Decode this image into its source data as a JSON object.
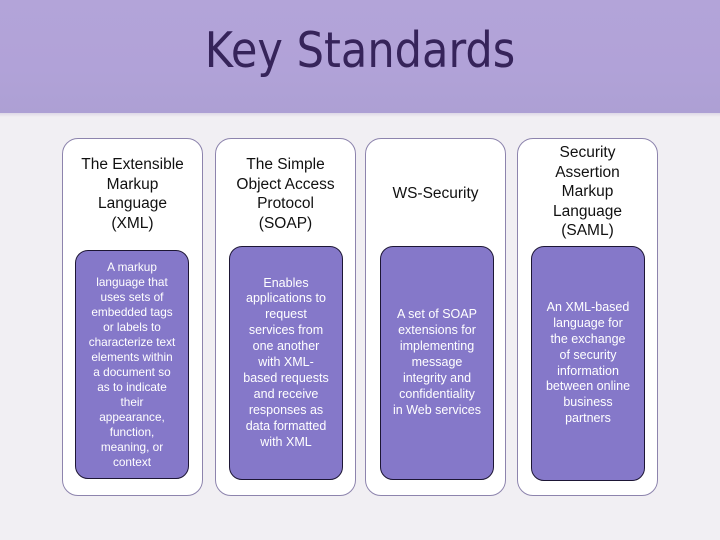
{
  "slide": {
    "title": "Key Standards",
    "colors": {
      "header_band": "#b1a2d8",
      "title_text": "#36245a",
      "card_background": "#ffffff",
      "card_border": "#8d84ad",
      "description_box": "#8578c9",
      "description_border": "#1d1635",
      "description_text": "#ffffff"
    },
    "standards": [
      {
        "name": "The Extensible Markup Language (XML)",
        "name_lines": [
          "The Extensible",
          "Markup",
          "Language",
          "(XML)"
        ],
        "description": "A markup language that uses sets of embedded tags or labels to characterize text elements within a document so as to indicate their appearance, function, meaning, or context",
        "description_lines": [
          "A markup",
          "language that",
          "uses sets of",
          "embedded tags",
          "or labels to",
          "characterize text",
          "elements within",
          "a document so",
          "as to indicate",
          "their",
          "appearance,",
          "function,",
          "meaning, or",
          "context"
        ]
      },
      {
        "name": "The Simple Object Access Protocol (SOAP)",
        "name_lines": [
          "The Simple",
          "Object Access",
          "Protocol",
          "(SOAP)"
        ],
        "description": "Enables applications to request services from one another with XML-based requests and receive responses as data formatted with XML",
        "description_lines": [
          "Enables",
          "applications to",
          "request",
          "services from",
          "one another",
          "with XML-",
          "based requests",
          "and receive",
          "responses as",
          "data formatted",
          "with XML"
        ]
      },
      {
        "name": "WS-Security",
        "name_lines": [
          "WS-Security"
        ],
        "description": "A set of SOAP extensions for implementing message integrity and confidentiality in Web services",
        "description_lines": [
          "A set of SOAP",
          "extensions for",
          "implementing",
          "message",
          "integrity and",
          "confidentiality",
          "in Web services"
        ]
      },
      {
        "name": "Security Assertion Markup Language (SAML)",
        "name_lines": [
          "Security",
          "Assertion",
          "Markup",
          "Language",
          "(SAML)"
        ],
        "description": "An XML-based language for the exchange of security information between online business partners",
        "description_lines": [
          "An XML-based",
          "language for",
          "the exchange",
          "of security",
          "information",
          "between online",
          "business",
          "partners"
        ]
      }
    ]
  }
}
